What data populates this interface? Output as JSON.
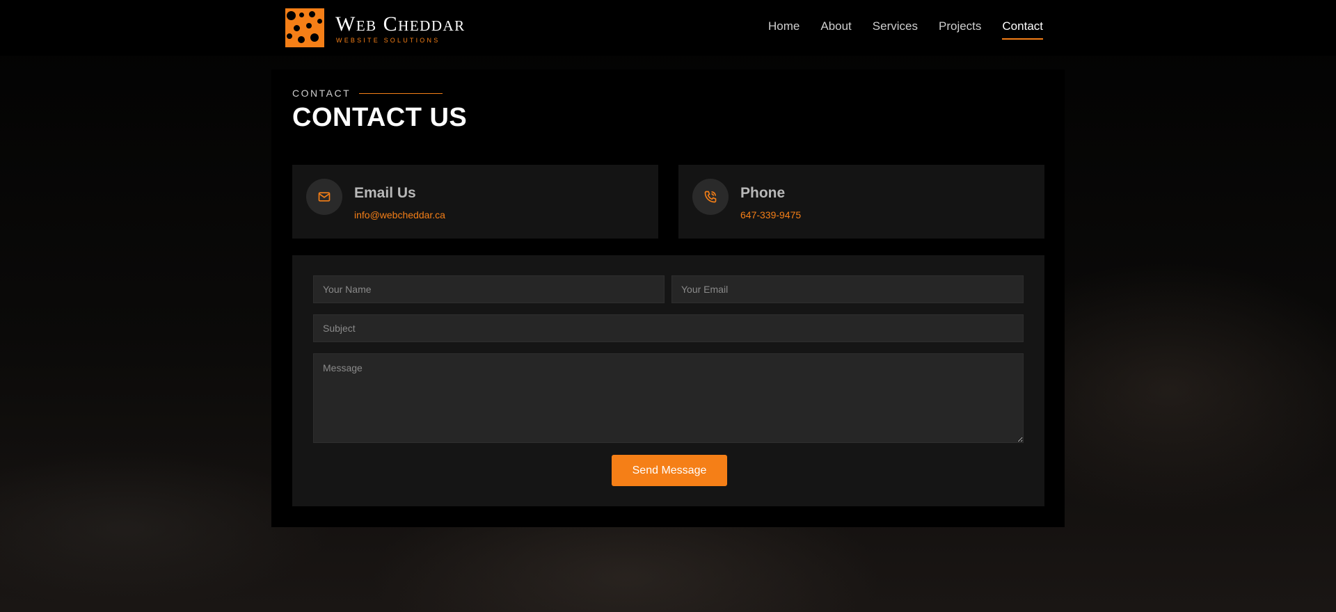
{
  "brand": {
    "name": "Web Cheddar",
    "tagline": "WEBSITE SOLUTIONS",
    "logo_icon": "cheese-icon",
    "accent_color": "#f57f17"
  },
  "nav": {
    "items": [
      {
        "label": "Home",
        "active": false
      },
      {
        "label": "About",
        "active": false
      },
      {
        "label": "Services",
        "active": false
      },
      {
        "label": "Projects",
        "active": false
      },
      {
        "label": "Contact",
        "active": true
      }
    ]
  },
  "section": {
    "eyebrow": "CONTACT",
    "title": "CONTACT US"
  },
  "info_cards": {
    "email": {
      "title": "Email Us",
      "value": "info@webcheddar.ca",
      "icon": "mail-icon"
    },
    "phone": {
      "title": "Phone",
      "value": "647-339-9475",
      "icon": "phone-icon"
    }
  },
  "form": {
    "name_placeholder": "Your Name",
    "email_placeholder": "Your Email",
    "subject_placeholder": "Subject",
    "message_placeholder": "Message",
    "submit_label": "Send Message"
  }
}
